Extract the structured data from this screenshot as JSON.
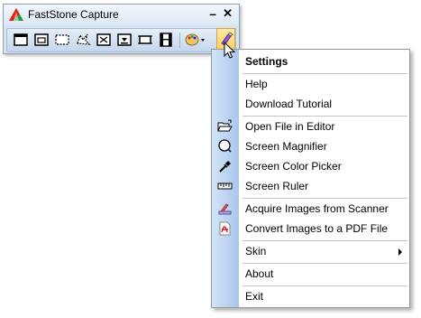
{
  "window": {
    "title": "FastStone Capture",
    "minimize_glyph": "–",
    "close_glyph": "✕"
  },
  "toolbar": {
    "tools": [
      {
        "icon": "capture-active-window-icon"
      },
      {
        "icon": "capture-window-object-icon"
      },
      {
        "icon": "capture-rectangular-region-icon"
      },
      {
        "icon": "capture-freehand-region-icon"
      },
      {
        "icon": "capture-full-screen-icon"
      },
      {
        "icon": "capture-scrolling-window-icon"
      },
      {
        "icon": "capture-fixed-region-icon"
      },
      {
        "icon": "screen-recorder-icon"
      },
      {
        "icon": "output-palette-icon"
      },
      {
        "icon": "settings-icon"
      }
    ]
  },
  "menu": {
    "items": [
      {
        "label": "Settings",
        "icon": "",
        "bold": true
      },
      {
        "label": "Help",
        "icon": ""
      },
      {
        "label": "Download Tutorial",
        "icon": ""
      },
      {
        "label": "Open File in Editor",
        "icon": "open-folder-icon"
      },
      {
        "label": "Screen Magnifier",
        "icon": "magnifier-icon"
      },
      {
        "label": "Screen Color Picker",
        "icon": "eyedropper-icon"
      },
      {
        "label": "Screen Ruler",
        "icon": "ruler-icon"
      },
      {
        "label": "Acquire Images from Scanner",
        "icon": "scanner-icon"
      },
      {
        "label": "Convert Images to a PDF File",
        "icon": "pdf-icon"
      },
      {
        "label": "Skin",
        "icon": "",
        "submenu": true
      },
      {
        "label": "About",
        "icon": ""
      },
      {
        "label": "Exit",
        "icon": ""
      }
    ]
  },
  "colors": {
    "menu_strip": "#a9c6ec",
    "active_button": "#ffcf62",
    "toolbar_bg": "#d6e4f4"
  }
}
